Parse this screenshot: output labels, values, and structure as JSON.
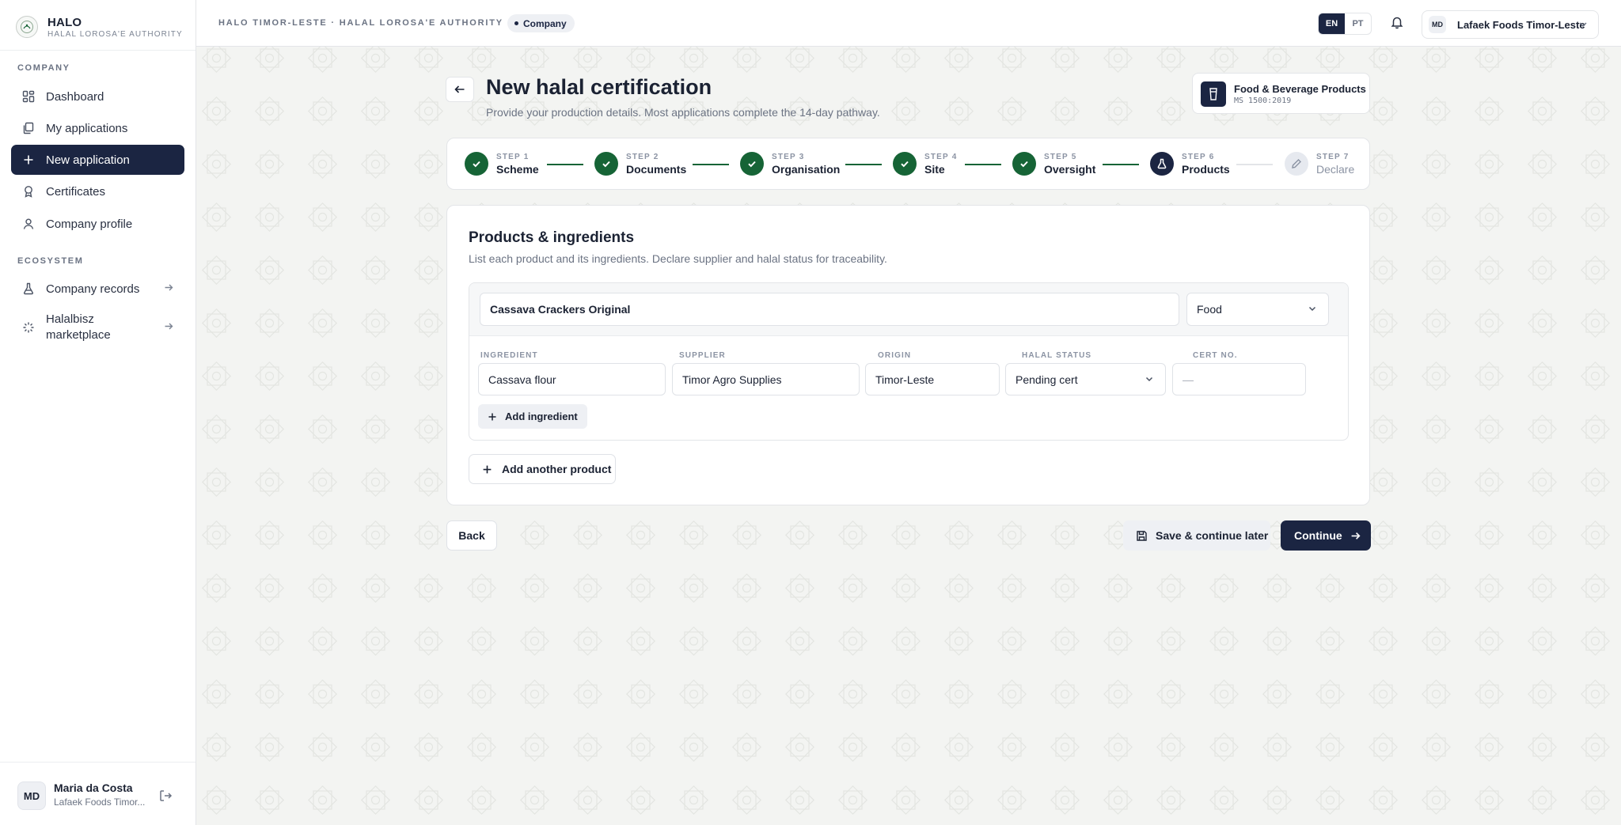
{
  "brand": {
    "name": "HALO",
    "subtitle": "HALAL LOROSA'E AUTHORITY"
  },
  "sidebar": {
    "section_company": "COMPANY",
    "items": [
      {
        "label": "Dashboard",
        "icon": "dashboard-icon"
      },
      {
        "label": "My applications",
        "icon": "copy-icon"
      },
      {
        "label": "New application",
        "icon": "plus-icon",
        "active": true
      },
      {
        "label": "Certificates",
        "icon": "award-icon"
      },
      {
        "label": "Company profile",
        "icon": "user-icon"
      }
    ],
    "section_ecosystem": "ECOSYSTEM",
    "eco_items": [
      {
        "label": "Company records",
        "icon": "flask-icon"
      },
      {
        "label": "Halalbisz marketplace",
        "icon": "sparkle-icon"
      }
    ],
    "user": {
      "initials": "MD",
      "name": "Maria da Costa",
      "org": "Lafaek Foods Timor..."
    }
  },
  "topbar": {
    "breadcrumb": "HALO TIMOR-LESTE · HALAL LOROSA'E AUTHORITY",
    "role_badge": "Company",
    "languages": [
      "EN",
      "PT"
    ],
    "active_language": "EN",
    "org_initials": "MD",
    "org_name": "Lafaek Foods Timor-Leste"
  },
  "page": {
    "title": "New halal certification",
    "subtitle": "Provide your production details. Most applications complete the 14-day pathway.",
    "scheme": {
      "name": "Food & Beverage Products",
      "code": "MS 1500:2019"
    }
  },
  "stepper": {
    "steps": [
      {
        "num": "STEP 1",
        "label": "Scheme",
        "state": "done"
      },
      {
        "num": "STEP 2",
        "label": "Documents",
        "state": "done"
      },
      {
        "num": "STEP 3",
        "label": "Organisation",
        "state": "done"
      },
      {
        "num": "STEP 4",
        "label": "Site",
        "state": "done"
      },
      {
        "num": "STEP 5",
        "label": "Oversight",
        "state": "done"
      },
      {
        "num": "STEP 6",
        "label": "Products",
        "state": "current"
      },
      {
        "num": "STEP 7",
        "label": "Declare",
        "state": "todo"
      }
    ]
  },
  "products": {
    "title": "Products & ingredients",
    "subtitle": "List each product and its ingredients. Declare supplier and halal status for traceability.",
    "product_name": "Cassava Crackers Original",
    "category": "Food",
    "columns": {
      "ingredient": "INGREDIENT",
      "supplier": "SUPPLIER",
      "origin": "ORIGIN",
      "halal_status": "HALAL STATUS",
      "cert_no": "CERT NO."
    },
    "ingredient_row": {
      "ingredient": "Cassava flour",
      "supplier": "Timor Agro Supplies",
      "origin": "Timor-Leste",
      "halal_status": "Pending cert",
      "cert_no_placeholder": "—"
    },
    "add_ingredient": "Add ingredient",
    "add_product": "Add another product"
  },
  "actions": {
    "back": "Back",
    "save": "Save & continue later",
    "continue": "Continue"
  },
  "colors": {
    "navy": "#1b2542",
    "green": "#166436",
    "background": "#f3f4f2"
  }
}
